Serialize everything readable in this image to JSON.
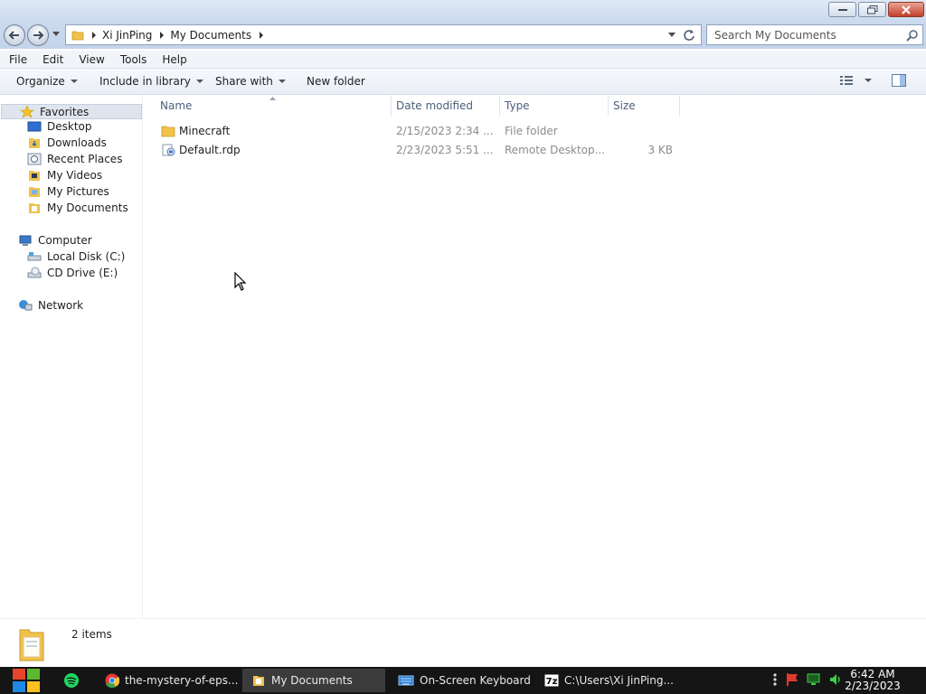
{
  "window": {
    "controls": {
      "minimize": "minimize-icon",
      "maximize": "restore-icon",
      "close": "close-icon"
    }
  },
  "address": {
    "breadcrumbs": [
      "Xi JinPing",
      "My Documents"
    ],
    "search_placeholder": "Search My Documents"
  },
  "menu": [
    "File",
    "Edit",
    "View",
    "Tools",
    "Help"
  ],
  "commands": {
    "organize": "Organize",
    "include_in_library": "Include in library",
    "share_with": "Share with",
    "new_folder": "New folder"
  },
  "nav": {
    "favorites": "Favorites",
    "favorites_items": [
      "Desktop",
      "Downloads",
      "Recent Places",
      "My Videos",
      "My Pictures",
      "My Documents"
    ],
    "computer": "Computer",
    "computer_items": [
      "Local Disk (C:)",
      "CD Drive (E:)"
    ],
    "network": "Network"
  },
  "columns": {
    "name": "Name",
    "date": "Date modified",
    "type": "Type",
    "size": "Size"
  },
  "files": [
    {
      "name": "Minecraft",
      "date": "2/15/2023 2:34 ...",
      "type": "File folder",
      "size": "",
      "icon": "folder-icon"
    },
    {
      "name": "Default.rdp",
      "date": "2/23/2023 5:51 ...",
      "type": "Remote Desktop...",
      "size": "3 KB",
      "icon": "rdp-file-icon"
    }
  ],
  "status": {
    "count": "2 items"
  },
  "taskbar": {
    "items": [
      "the-mystery-of-eps...",
      "My Documents",
      "On-Screen Keyboard",
      "C:\\Users\\Xi JinPing..."
    ],
    "time": "6:42 AM",
    "date": "2/23/2023"
  },
  "colors": {
    "selection": "#dfe5ef",
    "taskbar": "#151515",
    "folder": "#f0c24b",
    "close_button": "#c3402a"
  }
}
